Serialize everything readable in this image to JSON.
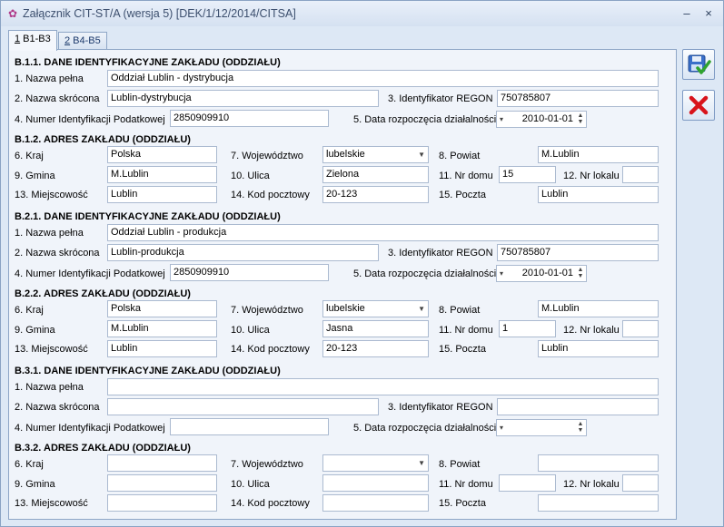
{
  "window": {
    "title": "Załącznik CIT-ST/A (wersja 5) [DEK/1/12/2014/CITSA]",
    "minimize_label": "–",
    "close_label": "×"
  },
  "tabs": [
    {
      "key": "1",
      "label": " B1-B3"
    },
    {
      "key": "2",
      "label": " B4-B5"
    }
  ],
  "labels": {
    "nazwa_pelna": "1. Nazwa pełna",
    "nazwa_skrocona": "2. Nazwa skrócona",
    "regon": "3. Identyfikator REGON",
    "nip": "4. Numer Identyfikacji Podatkowej",
    "data_rozp": "5. Data rozpoczęcia działalności",
    "kraj": "6. Kraj",
    "wojewodztwo": "7. Województwo",
    "powiat": "8. Powiat",
    "gmina": "9. Gmina",
    "ulica": "10. Ulica",
    "nr_domu": "11. Nr domu",
    "nr_lokalu": "12. Nr lokalu",
    "miejscowosc": "13. Miejscowość",
    "kod_pocztowy": "14. Kod pocztowy",
    "poczta": "15. Poczta"
  },
  "sections": [
    {
      "id_header": "B.1.1. DANE IDENTYFIKACYJNE ZAKŁADU (ODDZIAŁU)",
      "addr_header": "B.1.2. ADRES ZAKŁADU (ODDZIAŁU)",
      "nazwa_pelna": "Oddział Lublin - dystrybucja",
      "nazwa_skrocona": "Lublin-dystrybucja",
      "regon": "750785807",
      "nip": "2850909910",
      "data_rozp": "2010-01-01",
      "kraj": "Polska",
      "wojewodztwo": "lubelskie",
      "powiat": "M.Lublin",
      "gmina": "M.Lublin",
      "ulica": "Zielona",
      "nr_domu": "15",
      "nr_lokalu": "",
      "miejscowosc": "Lublin",
      "kod_pocztowy": "20-123",
      "poczta": "Lublin"
    },
    {
      "id_header": "B.2.1. DANE IDENTYFIKACYJNE ZAKŁADU (ODDZIAŁU)",
      "addr_header": "B.2.2. ADRES ZAKŁADU (ODDZIAŁU)",
      "nazwa_pelna": "Oddział Lublin - produkcja",
      "nazwa_skrocona": "Lublin-produkcja",
      "regon": "750785807",
      "nip": "2850909910",
      "data_rozp": "2010-01-01",
      "kraj": "Polska",
      "wojewodztwo": "lubelskie",
      "powiat": "M.Lublin",
      "gmina": "M.Lublin",
      "ulica": "Jasna",
      "nr_domu": "1",
      "nr_lokalu": "",
      "miejscowosc": "Lublin",
      "kod_pocztowy": "20-123",
      "poczta": "Lublin"
    },
    {
      "id_header": "B.3.1. DANE IDENTYFIKACYJNE ZAKŁADU (ODDZIAŁU)",
      "addr_header": "B.3.2. ADRES ZAKŁADU (ODDZIAŁU)",
      "nazwa_pelna": "",
      "nazwa_skrocona": "",
      "regon": "",
      "nip": "",
      "data_rozp": "",
      "kraj": "",
      "wojewodztwo": "",
      "powiat": "",
      "gmina": "",
      "ulica": "",
      "nr_domu": "",
      "nr_lokalu": "",
      "miejscowosc": "",
      "kod_pocztowy": "",
      "poczta": ""
    }
  ],
  "icons": {
    "save": "save-icon",
    "cancel": "cancel-icon"
  }
}
